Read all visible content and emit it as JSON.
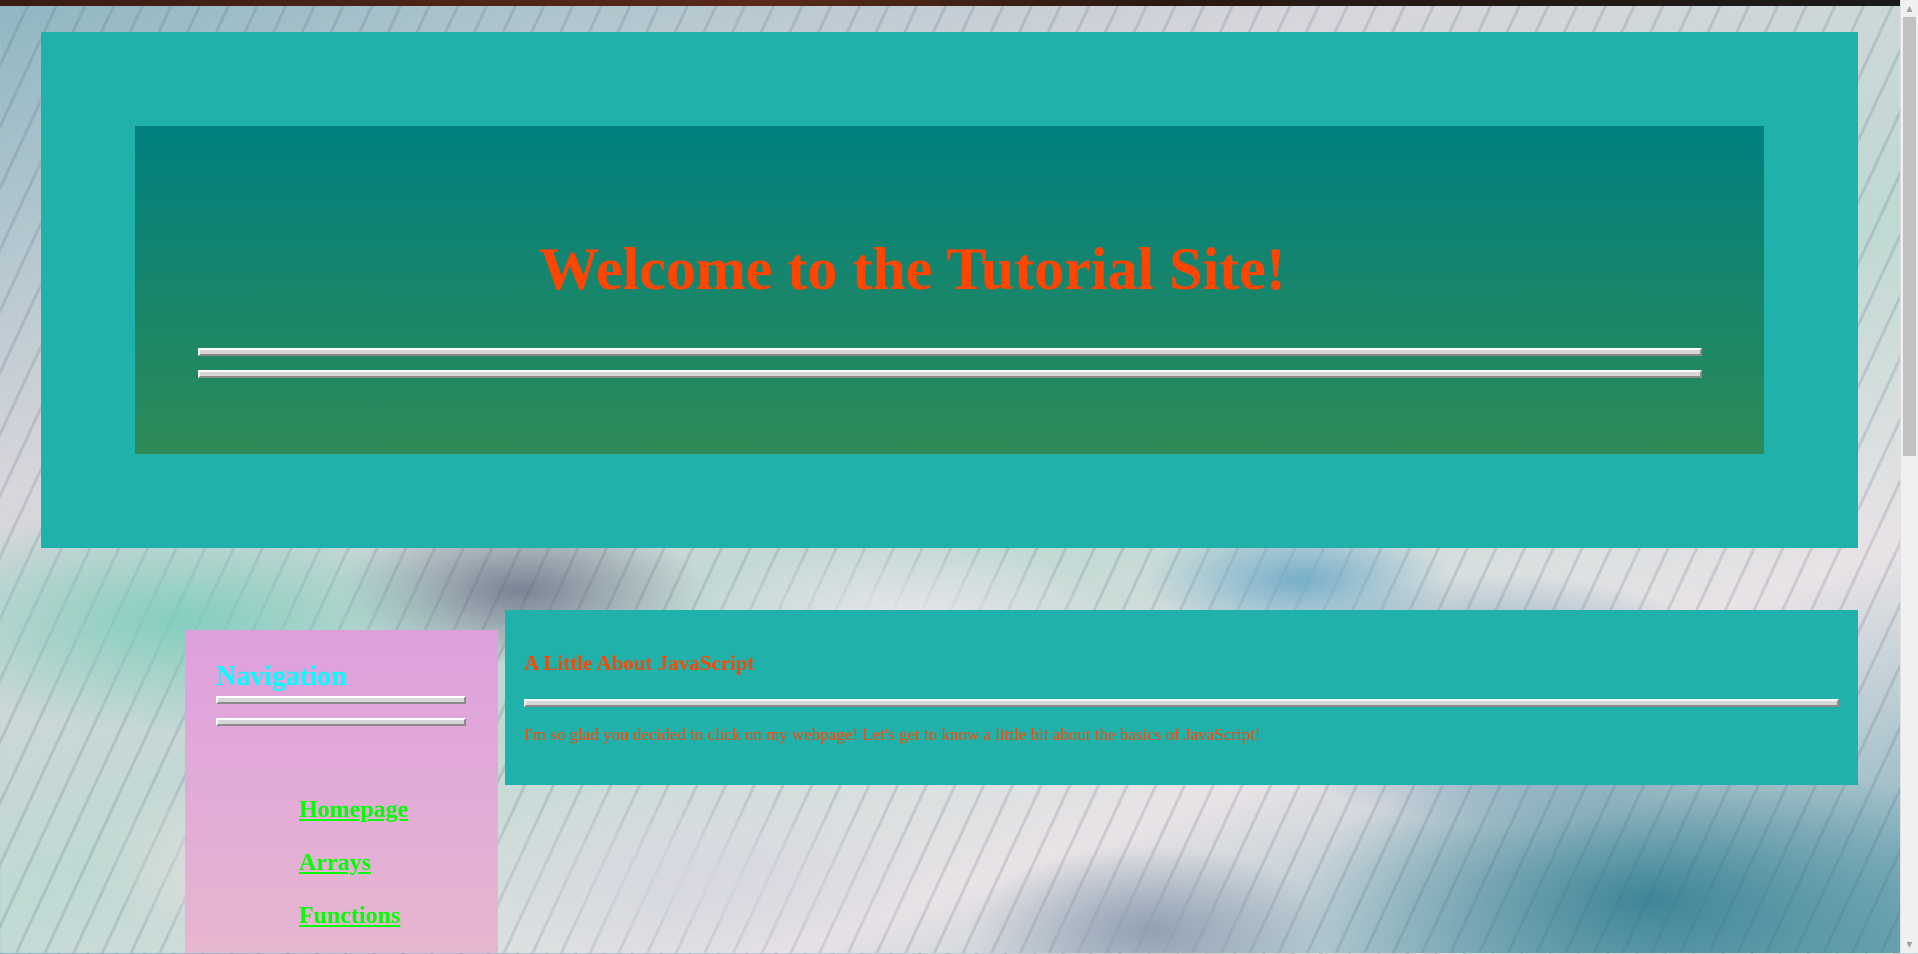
{
  "header": {
    "title": "Welcome to the Tutorial Site!"
  },
  "navigation": {
    "title": "Navigation",
    "items": [
      {
        "label": "Homepage"
      },
      {
        "label": "Arrays"
      },
      {
        "label": "Functions"
      }
    ]
  },
  "content": {
    "title": "A Little About JavaScript",
    "intro": "I'm so glad you decided to click on my webpage! Let's get to know a little bit about the basics of JavaScript!"
  },
  "colors": {
    "header_outer": "#20b2aa",
    "header_inner_top": "#008080",
    "header_inner_bottom": "#2e8b57",
    "title_text": "#ff4500",
    "nav_background": "#dea0dd",
    "nav_title": "#00ffff",
    "nav_links": "#00ff00",
    "content_background": "#20b2aa"
  },
  "icons": {
    "scroll_up": "triangle-up-icon",
    "scroll_down": "triangle-down-icon"
  }
}
